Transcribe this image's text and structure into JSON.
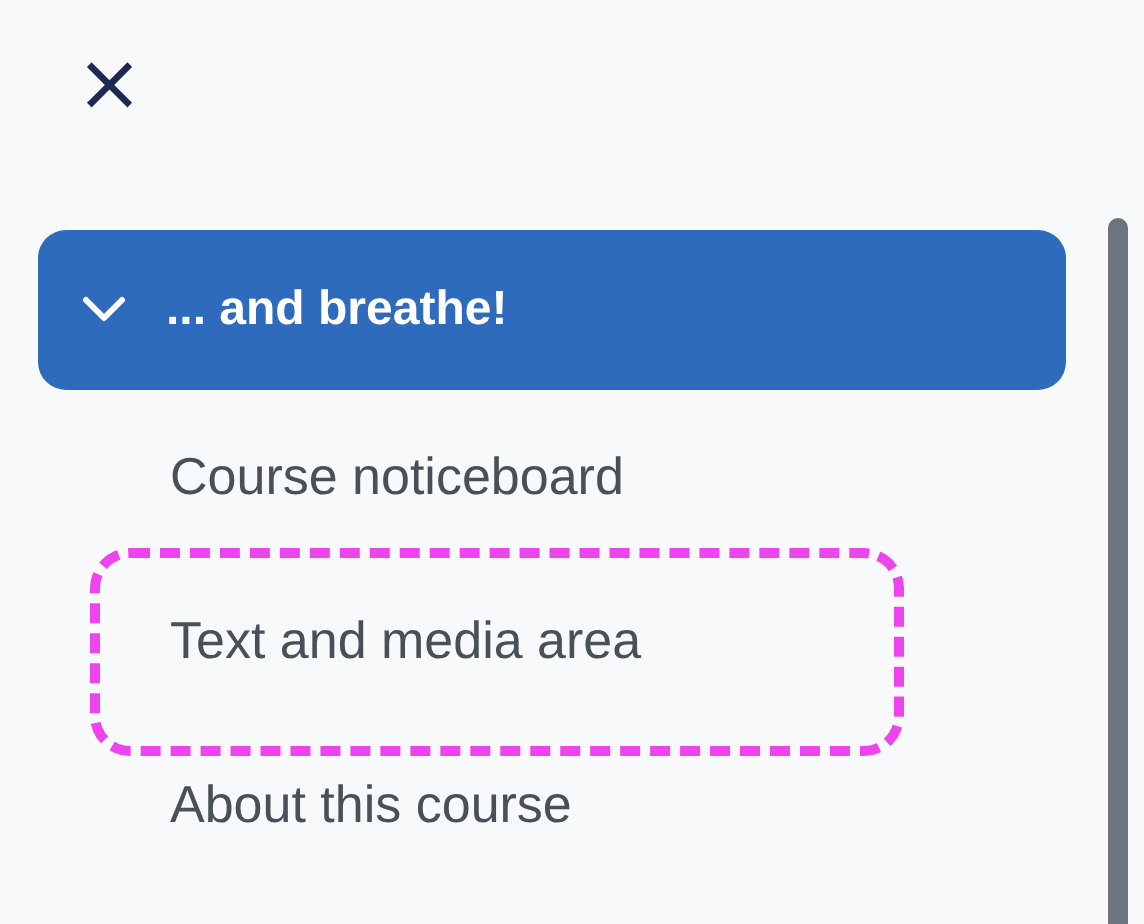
{
  "close_button": {
    "label": "×"
  },
  "section": {
    "title": "... and breathe!",
    "expanded": true,
    "items": [
      {
        "label": "Course noticeboard",
        "highlighted": false
      },
      {
        "label": "Text and media area",
        "highlighted": true
      },
      {
        "label": "About this course",
        "highlighted": false
      }
    ]
  }
}
